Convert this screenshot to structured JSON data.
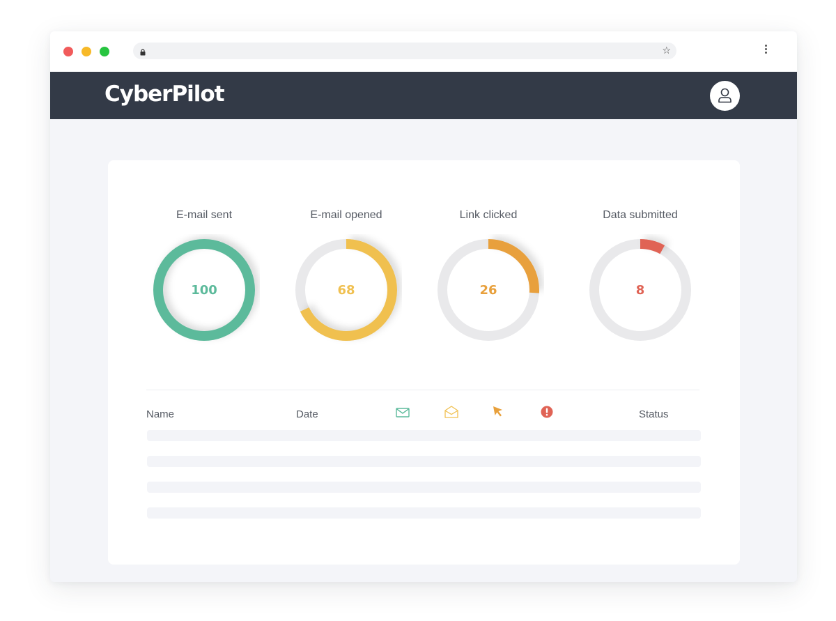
{
  "app": {
    "title": "CyberPilot"
  },
  "browser": {
    "lock_icon": "lock-icon",
    "star_icon": "star-icon",
    "star_glyph": "☆",
    "menu_icon": "kebab-menu-icon",
    "traffic_lights": {
      "close": "#f15b5b",
      "minimize": "#f7b928",
      "maximize": "#27c440"
    }
  },
  "header": {
    "user_icon": "user-icon"
  },
  "metrics": [
    {
      "label": "E-mail sent",
      "value": "100",
      "fraction": 1.0,
      "color": "#5cba9b"
    },
    {
      "label": "E-mail opened",
      "value": "68",
      "fraction": 0.68,
      "color": "#f0c050"
    },
    {
      "label": "Link clicked",
      "value": "26",
      "fraction": 0.26,
      "color": "#e8a03c"
    },
    {
      "label": "Data submitted",
      "value": "8",
      "fraction": 0.08,
      "color": "#e06355"
    }
  ],
  "ring_track_color": "#e9e9eb",
  "table": {
    "columns": {
      "name": "Name",
      "date": "Date",
      "status": "Status"
    },
    "icon_columns": [
      {
        "icon": "envelope-icon",
        "color": "#5cba9b"
      },
      {
        "icon": "open-envelope-icon",
        "color": "#f0c050"
      },
      {
        "icon": "cursor-icon",
        "color": "#e8a03c"
      },
      {
        "icon": "alert-icon",
        "color": "#e06355"
      }
    ]
  }
}
